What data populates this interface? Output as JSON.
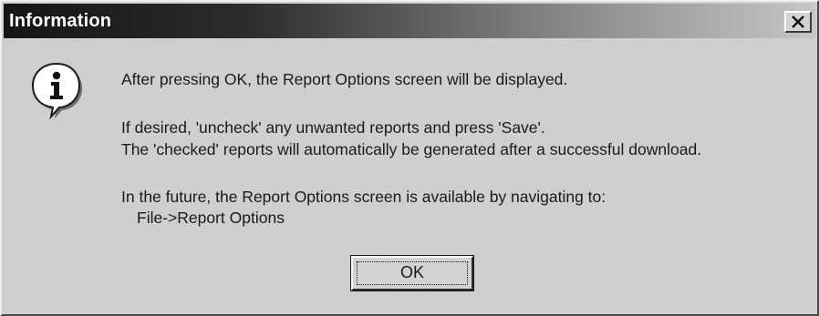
{
  "dialog": {
    "title": "Information",
    "icon": "info-icon",
    "message": {
      "line1": "After pressing OK, the Report Options screen will be displayed.",
      "line2": "If desired, 'uncheck' any unwanted reports and press 'Save'.",
      "line3": "The 'checked' reports will automatically be generated after a successful download.",
      "line4": "In the future, the Report Options screen is available by navigating to:",
      "line5": "File->Report Options"
    },
    "ok_label": "OK",
    "close_icon": "close-icon"
  }
}
